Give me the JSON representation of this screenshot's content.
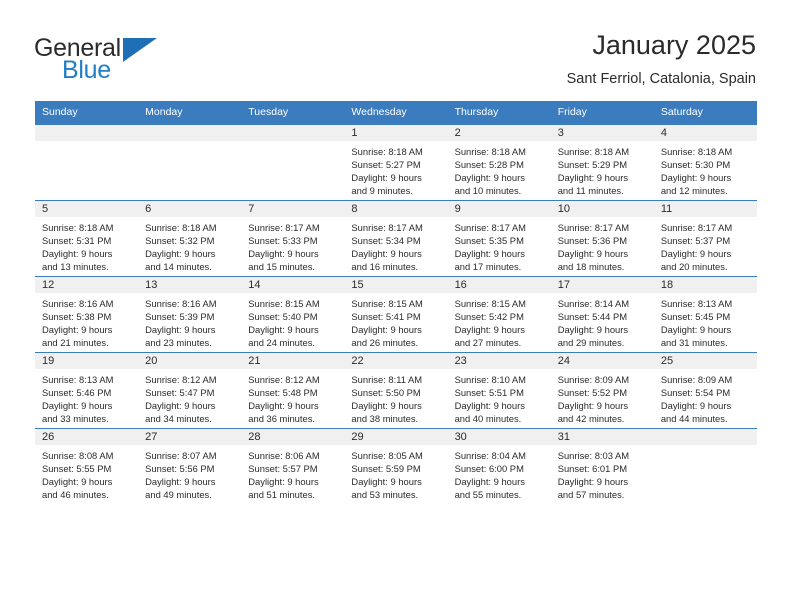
{
  "brand": {
    "name_part1": "General",
    "name_part2": "Blue",
    "logo_icon": "triangle-logo-icon",
    "accent_color": "#1f7ec4"
  },
  "header": {
    "title": "January 2025",
    "subtitle": "Sant Ferriol, Catalonia, Spain"
  },
  "theme": {
    "header_row_bg": "#3a7cbe",
    "daynum_strip_bg": "#f0f0f0",
    "text_color": "#2b2b2b"
  },
  "weekday_headers": [
    "Sunday",
    "Monday",
    "Tuesday",
    "Wednesday",
    "Thursday",
    "Friday",
    "Saturday"
  ],
  "weeks": [
    [
      {
        "day": "",
        "empty": true,
        "sunrise": "",
        "sunset": "",
        "daylight_line1": "",
        "daylight_line2": ""
      },
      {
        "day": "",
        "empty": true,
        "sunrise": "",
        "sunset": "",
        "daylight_line1": "",
        "daylight_line2": ""
      },
      {
        "day": "",
        "empty": true,
        "sunrise": "",
        "sunset": "",
        "daylight_line1": "",
        "daylight_line2": ""
      },
      {
        "day": "1",
        "empty": false,
        "sunrise": "Sunrise: 8:18 AM",
        "sunset": "Sunset: 5:27 PM",
        "daylight_line1": "Daylight: 9 hours",
        "daylight_line2": "and 9 minutes."
      },
      {
        "day": "2",
        "empty": false,
        "sunrise": "Sunrise: 8:18 AM",
        "sunset": "Sunset: 5:28 PM",
        "daylight_line1": "Daylight: 9 hours",
        "daylight_line2": "and 10 minutes."
      },
      {
        "day": "3",
        "empty": false,
        "sunrise": "Sunrise: 8:18 AM",
        "sunset": "Sunset: 5:29 PM",
        "daylight_line1": "Daylight: 9 hours",
        "daylight_line2": "and 11 minutes."
      },
      {
        "day": "4",
        "empty": false,
        "sunrise": "Sunrise: 8:18 AM",
        "sunset": "Sunset: 5:30 PM",
        "daylight_line1": "Daylight: 9 hours",
        "daylight_line2": "and 12 minutes."
      }
    ],
    [
      {
        "day": "5",
        "empty": false,
        "sunrise": "Sunrise: 8:18 AM",
        "sunset": "Sunset: 5:31 PM",
        "daylight_line1": "Daylight: 9 hours",
        "daylight_line2": "and 13 minutes."
      },
      {
        "day": "6",
        "empty": false,
        "sunrise": "Sunrise: 8:18 AM",
        "sunset": "Sunset: 5:32 PM",
        "daylight_line1": "Daylight: 9 hours",
        "daylight_line2": "and 14 minutes."
      },
      {
        "day": "7",
        "empty": false,
        "sunrise": "Sunrise: 8:17 AM",
        "sunset": "Sunset: 5:33 PM",
        "daylight_line1": "Daylight: 9 hours",
        "daylight_line2": "and 15 minutes."
      },
      {
        "day": "8",
        "empty": false,
        "sunrise": "Sunrise: 8:17 AM",
        "sunset": "Sunset: 5:34 PM",
        "daylight_line1": "Daylight: 9 hours",
        "daylight_line2": "and 16 minutes."
      },
      {
        "day": "9",
        "empty": false,
        "sunrise": "Sunrise: 8:17 AM",
        "sunset": "Sunset: 5:35 PM",
        "daylight_line1": "Daylight: 9 hours",
        "daylight_line2": "and 17 minutes."
      },
      {
        "day": "10",
        "empty": false,
        "sunrise": "Sunrise: 8:17 AM",
        "sunset": "Sunset: 5:36 PM",
        "daylight_line1": "Daylight: 9 hours",
        "daylight_line2": "and 18 minutes."
      },
      {
        "day": "11",
        "empty": false,
        "sunrise": "Sunrise: 8:17 AM",
        "sunset": "Sunset: 5:37 PM",
        "daylight_line1": "Daylight: 9 hours",
        "daylight_line2": "and 20 minutes."
      }
    ],
    [
      {
        "day": "12",
        "empty": false,
        "sunrise": "Sunrise: 8:16 AM",
        "sunset": "Sunset: 5:38 PM",
        "daylight_line1": "Daylight: 9 hours",
        "daylight_line2": "and 21 minutes."
      },
      {
        "day": "13",
        "empty": false,
        "sunrise": "Sunrise: 8:16 AM",
        "sunset": "Sunset: 5:39 PM",
        "daylight_line1": "Daylight: 9 hours",
        "daylight_line2": "and 23 minutes."
      },
      {
        "day": "14",
        "empty": false,
        "sunrise": "Sunrise: 8:15 AM",
        "sunset": "Sunset: 5:40 PM",
        "daylight_line1": "Daylight: 9 hours",
        "daylight_line2": "and 24 minutes."
      },
      {
        "day": "15",
        "empty": false,
        "sunrise": "Sunrise: 8:15 AM",
        "sunset": "Sunset: 5:41 PM",
        "daylight_line1": "Daylight: 9 hours",
        "daylight_line2": "and 26 minutes."
      },
      {
        "day": "16",
        "empty": false,
        "sunrise": "Sunrise: 8:15 AM",
        "sunset": "Sunset: 5:42 PM",
        "daylight_line1": "Daylight: 9 hours",
        "daylight_line2": "and 27 minutes."
      },
      {
        "day": "17",
        "empty": false,
        "sunrise": "Sunrise: 8:14 AM",
        "sunset": "Sunset: 5:44 PM",
        "daylight_line1": "Daylight: 9 hours",
        "daylight_line2": "and 29 minutes."
      },
      {
        "day": "18",
        "empty": false,
        "sunrise": "Sunrise: 8:13 AM",
        "sunset": "Sunset: 5:45 PM",
        "daylight_line1": "Daylight: 9 hours",
        "daylight_line2": "and 31 minutes."
      }
    ],
    [
      {
        "day": "19",
        "empty": false,
        "sunrise": "Sunrise: 8:13 AM",
        "sunset": "Sunset: 5:46 PM",
        "daylight_line1": "Daylight: 9 hours",
        "daylight_line2": "and 33 minutes."
      },
      {
        "day": "20",
        "empty": false,
        "sunrise": "Sunrise: 8:12 AM",
        "sunset": "Sunset: 5:47 PM",
        "daylight_line1": "Daylight: 9 hours",
        "daylight_line2": "and 34 minutes."
      },
      {
        "day": "21",
        "empty": false,
        "sunrise": "Sunrise: 8:12 AM",
        "sunset": "Sunset: 5:48 PM",
        "daylight_line1": "Daylight: 9 hours",
        "daylight_line2": "and 36 minutes."
      },
      {
        "day": "22",
        "empty": false,
        "sunrise": "Sunrise: 8:11 AM",
        "sunset": "Sunset: 5:50 PM",
        "daylight_line1": "Daylight: 9 hours",
        "daylight_line2": "and 38 minutes."
      },
      {
        "day": "23",
        "empty": false,
        "sunrise": "Sunrise: 8:10 AM",
        "sunset": "Sunset: 5:51 PM",
        "daylight_line1": "Daylight: 9 hours",
        "daylight_line2": "and 40 minutes."
      },
      {
        "day": "24",
        "empty": false,
        "sunrise": "Sunrise: 8:09 AM",
        "sunset": "Sunset: 5:52 PM",
        "daylight_line1": "Daylight: 9 hours",
        "daylight_line2": "and 42 minutes."
      },
      {
        "day": "25",
        "empty": false,
        "sunrise": "Sunrise: 8:09 AM",
        "sunset": "Sunset: 5:54 PM",
        "daylight_line1": "Daylight: 9 hours",
        "daylight_line2": "and 44 minutes."
      }
    ],
    [
      {
        "day": "26",
        "empty": false,
        "sunrise": "Sunrise: 8:08 AM",
        "sunset": "Sunset: 5:55 PM",
        "daylight_line1": "Daylight: 9 hours",
        "daylight_line2": "and 46 minutes."
      },
      {
        "day": "27",
        "empty": false,
        "sunrise": "Sunrise: 8:07 AM",
        "sunset": "Sunset: 5:56 PM",
        "daylight_line1": "Daylight: 9 hours",
        "daylight_line2": "and 49 minutes."
      },
      {
        "day": "28",
        "empty": false,
        "sunrise": "Sunrise: 8:06 AM",
        "sunset": "Sunset: 5:57 PM",
        "daylight_line1": "Daylight: 9 hours",
        "daylight_line2": "and 51 minutes."
      },
      {
        "day": "29",
        "empty": false,
        "sunrise": "Sunrise: 8:05 AM",
        "sunset": "Sunset: 5:59 PM",
        "daylight_line1": "Daylight: 9 hours",
        "daylight_line2": "and 53 minutes."
      },
      {
        "day": "30",
        "empty": false,
        "sunrise": "Sunrise: 8:04 AM",
        "sunset": "Sunset: 6:00 PM",
        "daylight_line1": "Daylight: 9 hours",
        "daylight_line2": "and 55 minutes."
      },
      {
        "day": "31",
        "empty": false,
        "sunrise": "Sunrise: 8:03 AM",
        "sunset": "Sunset: 6:01 PM",
        "daylight_line1": "Daylight: 9 hours",
        "daylight_line2": "and 57 minutes."
      },
      {
        "day": "",
        "empty": true,
        "sunrise": "",
        "sunset": "",
        "daylight_line1": "",
        "daylight_line2": ""
      }
    ]
  ]
}
